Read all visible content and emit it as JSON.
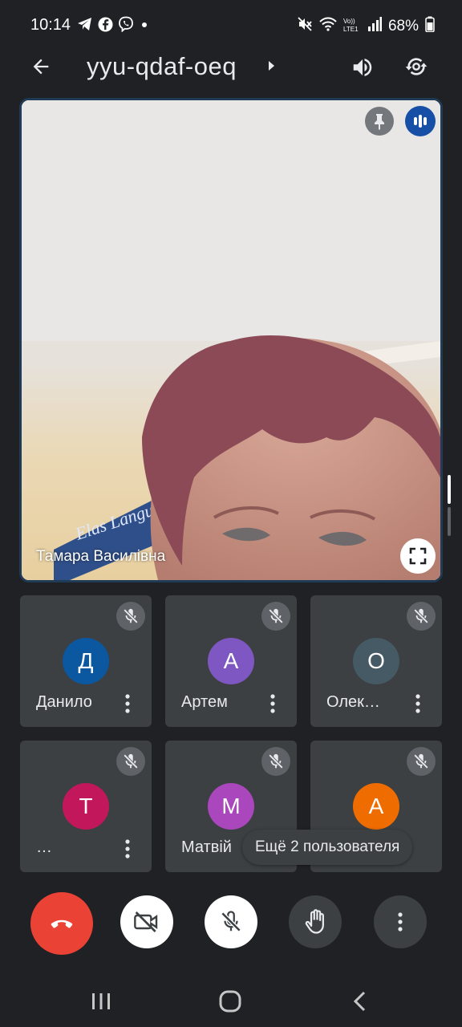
{
  "status_bar": {
    "time": "10:14",
    "left_icons": [
      "telegram-icon",
      "facebook-icon",
      "viber-icon",
      "dot-icon"
    ],
    "right_icons": [
      "mute-icon",
      "wifi-icon",
      "volte-icon",
      "signal-icon"
    ],
    "battery_text": "68%"
  },
  "header": {
    "meeting_code": "yyu-qdaf-oeq"
  },
  "main_video": {
    "participant_name": "Тамара Василівна"
  },
  "participants": [
    {
      "name": "Данило",
      "initial": "Д",
      "color": "#0b57a0"
    },
    {
      "name": "Артем",
      "initial": "А",
      "color": "#7e57c2"
    },
    {
      "name": "Олек…",
      "initial": "О",
      "color": "#455a64"
    },
    {
      "name": "…",
      "initial": "Т",
      "color": "#c2185b"
    },
    {
      "name": "Матвій",
      "initial": "М",
      "color": "#ab47bc"
    },
    {
      "name": "",
      "initial": "А",
      "color": "#ef6c00"
    }
  ],
  "toast": {
    "text": "Ещё 2 пользователя"
  },
  "controls": [
    "end-call",
    "camera-off",
    "mic-off",
    "raise-hand",
    "more-options"
  ],
  "colors": {
    "background": "#202124",
    "tile": "#3c4043",
    "end_call": "#ea4335",
    "active_speaker": "#174ea6"
  }
}
